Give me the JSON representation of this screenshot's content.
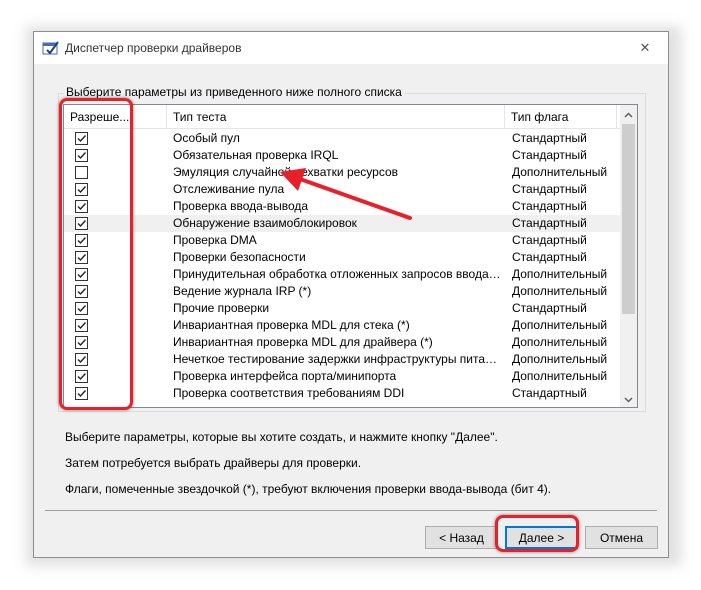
{
  "window": {
    "title": "Диспетчер проверки драйверов",
    "close_glyph": "✕"
  },
  "group": {
    "legend": "Выберите параметры из приведенного ниже полного списка"
  },
  "table": {
    "columns": [
      "Разреше...",
      "Тип теста",
      "Тип флага"
    ],
    "rows": [
      {
        "checked": true,
        "name": "Особый пул",
        "flag": "Стандартный"
      },
      {
        "checked": true,
        "name": "Обязательная проверка IRQL",
        "flag": "Стандартный"
      },
      {
        "checked": false,
        "name": "Эмуляция случайной нехватки ресурсов",
        "flag": "Дополнительный"
      },
      {
        "checked": true,
        "name": "Отслеживание пула",
        "flag": "Стандартный"
      },
      {
        "checked": true,
        "name": "Проверка ввода-вывода",
        "flag": "Стандартный"
      },
      {
        "checked": true,
        "name": "Обнаружение взаимоблокировок",
        "flag": "Стандартный"
      },
      {
        "checked": true,
        "name": "Проверка DMA",
        "flag": "Стандартный"
      },
      {
        "checked": true,
        "name": "Проверки безопасности",
        "flag": "Стандартный"
      },
      {
        "checked": true,
        "name": "Принудительная обработка отложенных запросов ввода-выво...",
        "flag": "Дополнительный"
      },
      {
        "checked": true,
        "name": "Ведение журнала IRP (*)",
        "flag": "Дополнительный"
      },
      {
        "checked": true,
        "name": "Прочие проверки",
        "flag": "Стандартный"
      },
      {
        "checked": true,
        "name": "Инвариантная проверка MDL для стека (*)",
        "flag": "Дополнительный"
      },
      {
        "checked": true,
        "name": "Инвариантная проверка MDL для драйвера (*)",
        "flag": "Дополнительный"
      },
      {
        "checked": true,
        "name": "Нечеткое тестирование задержки инфраструктуры питания",
        "flag": "Дополнительный"
      },
      {
        "checked": true,
        "name": "Проверка интерфейса порта/минипорта",
        "flag": "Дополнительный"
      },
      {
        "checked": true,
        "name": "Проверка соответствия требованиям DDI",
        "flag": "Стандартный"
      }
    ]
  },
  "hints": [
    "Выберите параметры, которые вы хотите создать, и нажмите кнопку \"Далее\".",
    "Затем потребуется выбрать драйверы для проверки.",
    "Флаги, помеченные звездочкой (*), требуют включения проверки ввода-вывода (бит 4)."
  ],
  "buttons": {
    "back": "< Назад",
    "next": "Далее >",
    "cancel": "Отмена"
  },
  "colors": {
    "annotation": "#e8202a",
    "accent": "#0078d7"
  }
}
